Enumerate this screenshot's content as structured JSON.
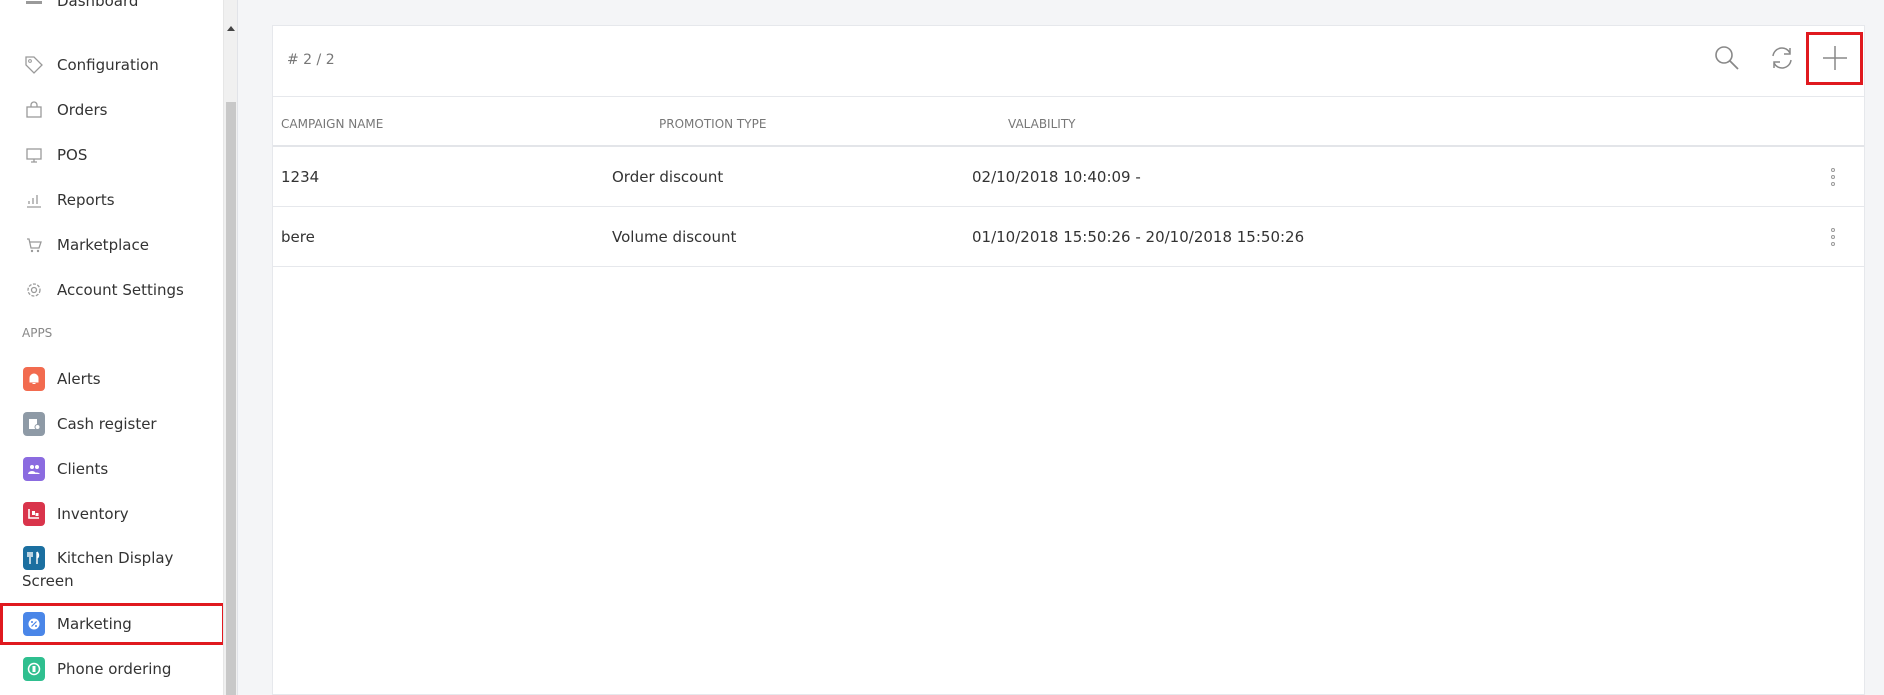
{
  "sidebar": {
    "partial_top": "Dashboard",
    "items": [
      {
        "label": "Configuration",
        "icon": "tag-icon"
      },
      {
        "label": "Orders",
        "icon": "bag-icon"
      },
      {
        "label": "POS",
        "icon": "monitor-icon"
      },
      {
        "label": "Reports",
        "icon": "chart-icon"
      },
      {
        "label": "Marketplace",
        "icon": "cart-icon"
      },
      {
        "label": "Account Settings",
        "icon": "gear-icon"
      }
    ],
    "section_label": "APPS",
    "apps": [
      {
        "label": "Alerts",
        "icon": "bell-icon",
        "color": "#f26b4f"
      },
      {
        "label": "Cash register",
        "icon": "cash-register-icon",
        "color": "#8e9aa6"
      },
      {
        "label": "Clients",
        "icon": "people-icon",
        "color": "#8b6be0"
      },
      {
        "label": "Inventory",
        "icon": "boxes-icon",
        "color": "#d9344b"
      },
      {
        "label": "Kitchen Display Screen",
        "label_line1": "Kitchen Display",
        "label_line2": "Screen",
        "icon": "cutlery-icon",
        "color": "#1b6fa0"
      },
      {
        "label": "Marketing",
        "icon": "percent-icon",
        "color": "#4a86e8"
      },
      {
        "label": "Phone ordering",
        "icon": "phone-icon",
        "color": "#2fbf8f"
      }
    ]
  },
  "list": {
    "count": "# 2 / 2",
    "columns": {
      "campaign": "CAMPAIGN NAME",
      "promotion": "PROMOTION TYPE",
      "validity": "VALABILITY"
    },
    "rows": [
      {
        "campaign": "1234",
        "promotion": "Order discount",
        "validity": "02/10/2018 10:40:09 -"
      },
      {
        "campaign": "bere",
        "promotion": "Volume discount",
        "validity": "01/10/2018 15:50:26 - 20/10/2018 15:50:26"
      }
    ]
  },
  "colors": {
    "highlight": "#e0191f",
    "icon_gray": "#9a9a9a"
  }
}
